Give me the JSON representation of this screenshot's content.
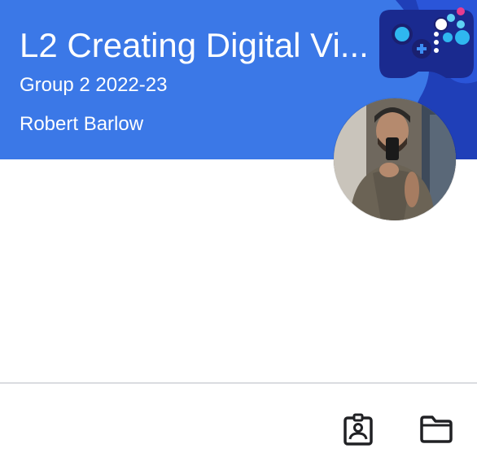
{
  "class_card": {
    "title": "L2 Creating Digital Vi...",
    "section": "Group 2 2022-23",
    "teacher": "Robert Barlow",
    "header_color": "#3b78e7"
  },
  "header_actions": {
    "more_icon": "more-vert-icon"
  },
  "footer": {
    "icons": [
      "assignment-ind-icon",
      "folder-icon"
    ]
  }
}
